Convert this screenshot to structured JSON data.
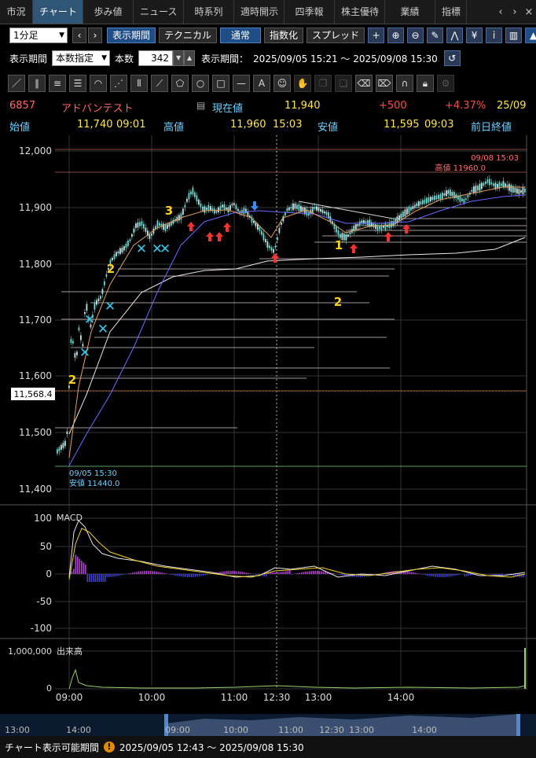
{
  "tabs": [
    "市況",
    "チャート",
    "歩み値",
    "ニュース",
    "時系列",
    "適時開示",
    "四季報",
    "株主優待",
    "業績",
    "指標"
  ],
  "tab_nav": {
    "left": "‹",
    "right": "›",
    "close": "×"
  },
  "toolbar": {
    "interval": "1分足",
    "display_period": "表示期間",
    "technical": "テクニカル",
    "normal": "通常",
    "index": "指数化",
    "spread": "スプレッド"
  },
  "period": {
    "label": "表示期間",
    "mode": "本数指定",
    "count_label": "本数",
    "count": "342",
    "range_label": "表示期間：",
    "range": "2025/09/05 15:21 ～ 2025/09/08 15:30"
  },
  "stock": {
    "code": "6857",
    "name": "アドバンテスト",
    "current_label": "現在値",
    "current": "11,940",
    "change": "+500",
    "change_pct": "+4.37%",
    "date": "25/09",
    "open_label": "始値",
    "open": "11,740",
    "open_time": "09:01",
    "high_label": "高値",
    "high": "11,960",
    "high_time": "15:03",
    "low_label": "安値",
    "low": "11,595",
    "low_time": "09:03",
    "prev_label": "前日終値"
  },
  "colors": {
    "up": "#ff4d4d",
    "name": "#ff6a6a",
    "cyan": "#6fd0ff",
    "yellow": "#ffe64d",
    "accent": "#2f5577"
  },
  "chart": {
    "y_labels": [
      "12,000",
      "11,900",
      "11,800",
      "11,700",
      "11,600",
      "11,500",
      "11,400"
    ],
    "price_tag": "11,568.4",
    "high_ann_time": "09/08 15:03",
    "high_ann": "高値 11960.0",
    "low_ann_time": "09/05 15:30",
    "low_ann": "安値 11440.0",
    "macd_label": "MACD",
    "macd_y": [
      "100",
      "50",
      "0",
      "-50",
      "-100"
    ],
    "vol_label": "出来高",
    "vol_y": "1,000,000",
    "vol_zero": "0",
    "x_labels": [
      "09:00",
      "10:00",
      "11:00",
      "12:30",
      "13:00",
      "14:00"
    ],
    "nav_labels": [
      "13:00",
      "14:00",
      "09:00",
      "10:00",
      "11:00",
      "12:30",
      "13:00",
      "14:00"
    ],
    "marker_counts": [
      "2",
      "2",
      "3",
      "1",
      "2"
    ]
  },
  "footer": {
    "label": "チャート表示可能期間",
    "warn": "!",
    "range": "2025/09/05 12:43 ～ 2025/09/08 15:30"
  }
}
